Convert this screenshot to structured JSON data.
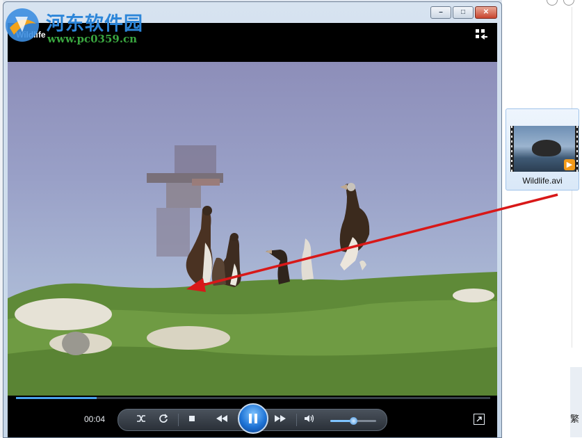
{
  "window": {
    "video_title": "Wildlife",
    "buttons": {
      "minimize": "–",
      "maximize": "□",
      "close": "✕"
    }
  },
  "player": {
    "elapsed_time": "00:04",
    "seek_progress": 0.17,
    "volume_level": 0.5,
    "icons": [
      "switch-to-library-icon",
      "shuffle-icon",
      "repeat-icon",
      "stop-icon",
      "previous-icon",
      "pause-icon",
      "next-icon",
      "mute-icon",
      "fullscreen-icon"
    ],
    "accent_color": "#1f74d6"
  },
  "desktop": {
    "file_label": "Wildlife.avi",
    "corner_text": "繁"
  },
  "watermark": {
    "site_name": "河东软件园",
    "url": "www.pc0359.cn"
  },
  "annotation": {
    "arrow_color": "#d81818"
  }
}
